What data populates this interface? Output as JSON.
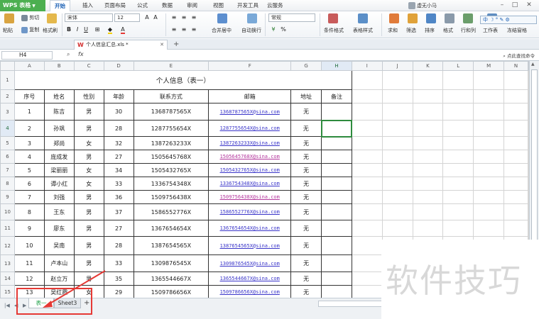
{
  "app": {
    "logo": "WPS 表格",
    "menu": [
      "开始",
      "插入",
      "页面布局",
      "公式",
      "数据",
      "审阅",
      "视图",
      "开发工具",
      "云服务"
    ],
    "active_menu": "开始",
    "user": "虚无小马"
  },
  "ribbon": {
    "cut": "剪切",
    "copy": "复制",
    "paste": "粘贴",
    "format_painter": "格式刷",
    "font_name": "宋体",
    "font_size": "12",
    "number_format": "常规",
    "merge_center": "合并居中",
    "wrap_text": "自动换行",
    "conditional_format": "条件格式",
    "table_style": "表格样式",
    "sum": "求和",
    "filter": "筛选",
    "sort": "排序",
    "format": "格式",
    "row_col": "行和列",
    "worksheet": "工作表",
    "freeze": "冻结窗格",
    "ime_label": "中"
  },
  "tabs": {
    "doc_tab": "个人信息汇总.xls *",
    "help": "点此查找命令"
  },
  "formula": {
    "name_box": "H4",
    "fx": "fx"
  },
  "sheet": {
    "columns": [
      "A",
      "B",
      "C",
      "D",
      "E",
      "F",
      "G",
      "H",
      "I",
      "J",
      "K",
      "L",
      "M",
      "N"
    ],
    "title": "个人信息（表一）",
    "headers": [
      "序号",
      "姓名",
      "性别",
      "年龄",
      "联系方式",
      "邮箱",
      "地址",
      "备注"
    ],
    "rows": [
      {
        "r": "3",
        "cells": [
          "1",
          "陈吉",
          "男",
          "30",
          "1368787565X",
          "1368787565X@sina.com",
          "无",
          ""
        ]
      },
      {
        "r": "4",
        "cells": [
          "2",
          "孙飒",
          "男",
          "28",
          "1287755654X",
          "1287755654X@sina.com",
          "无",
          ""
        ]
      },
      {
        "r": "5",
        "cells": [
          "3",
          "郑尚",
          "女",
          "32",
          "1387263233X",
          "1387263233X@sina.com",
          "无",
          ""
        ]
      },
      {
        "r": "6",
        "cells": [
          "4",
          "庞成发",
          "男",
          "27",
          "1505645768X",
          "1505645768X@sina.com",
          "无",
          ""
        ]
      },
      {
        "r": "7",
        "cells": [
          "5",
          "梁丽丽",
          "女",
          "34",
          "1505432765X",
          "1505432765X@sina.com",
          "无",
          ""
        ]
      },
      {
        "r": "8",
        "cells": [
          "6",
          "谭小红",
          "女",
          "33",
          "1336754348X",
          "1336754348X@sina.com",
          "无",
          ""
        ]
      },
      {
        "r": "9",
        "cells": [
          "7",
          "刘强",
          "男",
          "36",
          "1509756438X",
          "1509756438X@sina.com",
          "无",
          ""
        ]
      },
      {
        "r": "10",
        "cells": [
          "8",
          "王东",
          "男",
          "37",
          "1586552776X",
          "1586552776X@sina.com",
          "无",
          ""
        ]
      },
      {
        "r": "11",
        "cells": [
          "9",
          "廖东",
          "男",
          "27",
          "1367654654X",
          "1367654654X@sina.com",
          "无",
          ""
        ]
      },
      {
        "r": "12",
        "cells": [
          "10",
          "吴南",
          "男",
          "28",
          "1387654565X",
          "1387654565X@sina.com",
          "无",
          ""
        ]
      },
      {
        "r": "13",
        "cells": [
          "11",
          "卢本山",
          "男",
          "33",
          "1309876545X",
          "1309876545X@sina.com",
          "无",
          ""
        ]
      },
      {
        "r": "14",
        "cells": [
          "12",
          "赵立万",
          "男",
          "35",
          "1365544667X",
          "1365544667X@sina.com",
          "无",
          ""
        ]
      },
      {
        "r": "15",
        "cells": [
          "13",
          "吴红霞",
          "女",
          "29",
          "1509786656X",
          "1509786656X@sina.com",
          "无",
          ""
        ]
      }
    ]
  },
  "sheet_tabs": {
    "tabs": [
      "表一",
      "Sheet3"
    ],
    "active": "表一",
    "add": "+"
  },
  "watermark": "软件技巧",
  "colors": {
    "accent_green": "#2e8b3e",
    "link": "#3a35c9",
    "visited_link": "#b3359c",
    "annotation_red": "#e53935"
  }
}
